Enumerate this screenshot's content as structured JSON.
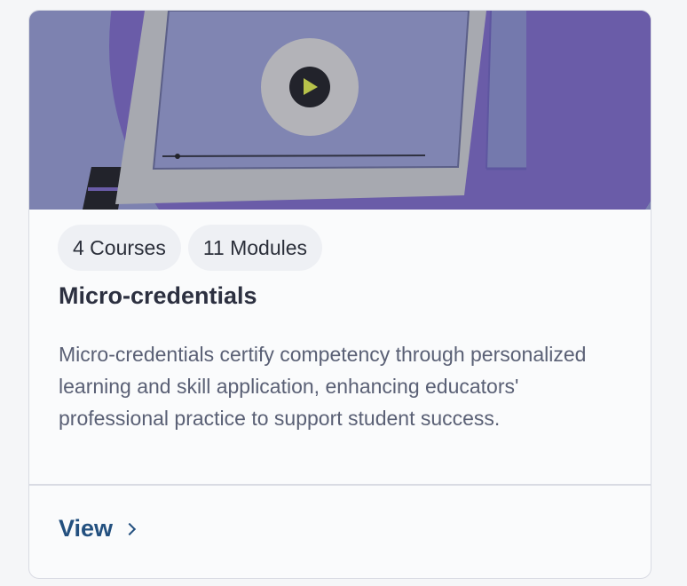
{
  "card": {
    "badges": [
      {
        "label": "4 Courses"
      },
      {
        "label": "11 Modules"
      }
    ],
    "title": "Micro-credentials",
    "description": "Micro-credentials certify competency through personalized learning and skill application, enhancing educators' professional practice to support student success.",
    "link": {
      "label": "View",
      "icon": "chevron-right-icon"
    },
    "hero": {
      "image": "laptop-video-illustration",
      "colors": {
        "background": "#7d82b0",
        "circle": "#6a5ca8",
        "screen_frame": "#a7a9b0",
        "screen": "#8085b2",
        "play_ring": "#b3b3b8",
        "play_button": "#22232b",
        "play_triangle": "#b7c24a"
      }
    }
  }
}
